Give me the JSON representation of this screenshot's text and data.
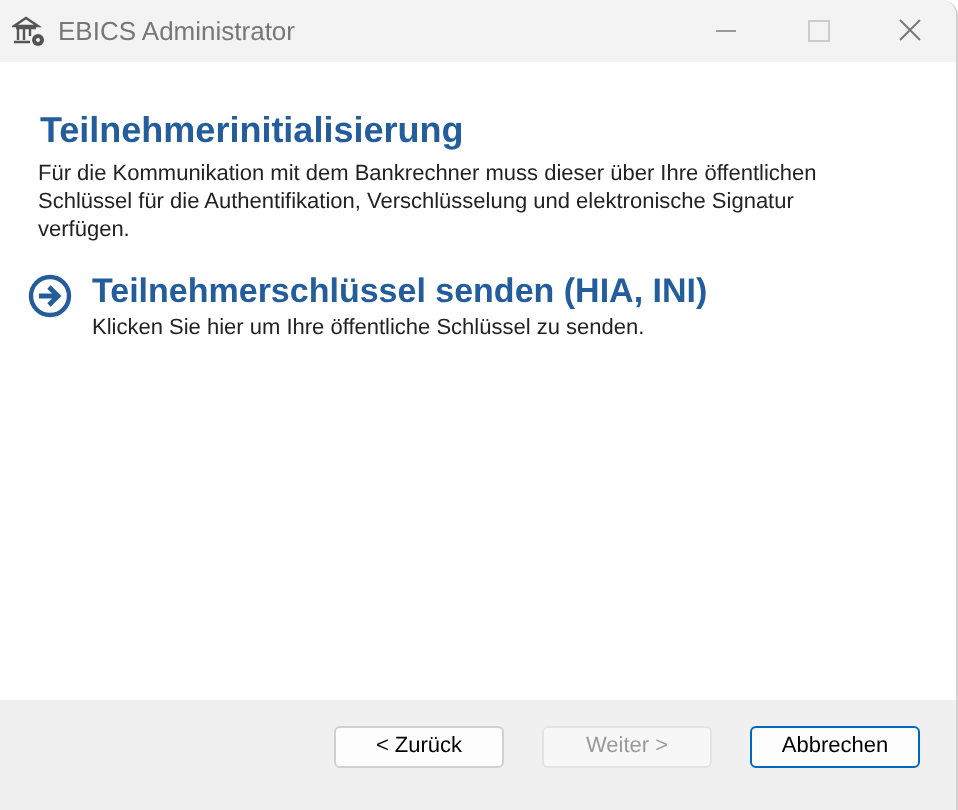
{
  "window": {
    "title": "EBICS Administrator"
  },
  "heading": "Teilnehmerinitialisierung",
  "description": "Für die Kommunikation mit dem Bankrechner muss dieser über Ihre öffentlichen Schlüssel für die Authentifikation, Verschlüsselung und elektronische Signatur verfügen.",
  "action": {
    "title": "Teilnehmerschlüssel senden (HIA, INI)",
    "subtitle": "Klicken Sie hier um Ihre öffentliche Schlüssel zu senden."
  },
  "buttons": [
    {
      "label": "< Zurück",
      "disabled": false,
      "default": false
    },
    {
      "label": "Weiter >",
      "disabled": true,
      "default": false
    },
    {
      "label": "Abbrechen",
      "disabled": false,
      "default": true
    }
  ]
}
